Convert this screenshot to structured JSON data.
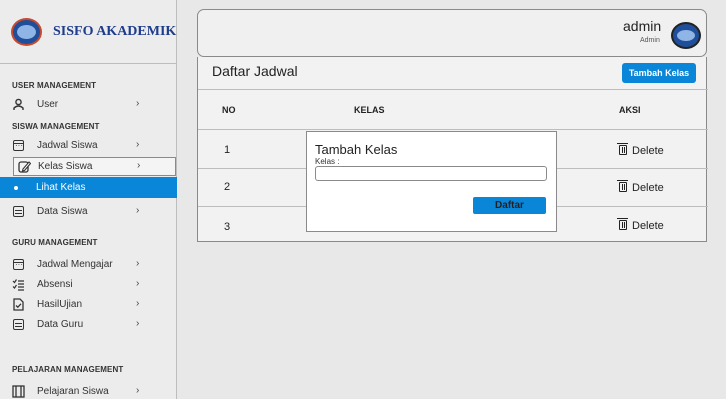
{
  "brand": {
    "title": "SISFO AKADEMIK"
  },
  "header": {
    "admin_name": "admin",
    "admin_role": "Admin"
  },
  "sidebar": {
    "user_section": "USER MANAGEMENT",
    "user_item": "User",
    "siswa_section": "SISWA MANAGEMENT",
    "siswa_items": [
      "Jadwal Siswa",
      "Kelas Siswa",
      "Lihat Kelas",
      "Data Siswa"
    ],
    "guru_section": "GURU MANAGEMENT",
    "guru_items": [
      "Jadwal Mengajar",
      "Absensi",
      "HasilUjian",
      "Data Guru"
    ],
    "pelajaran_section": "PELAJARAN MANAGEMENT",
    "pelajaran_items": [
      "Pelajaran Siswa"
    ],
    "active_item": "Lihat Kelas"
  },
  "main": {
    "title": "Daftar Jadwal",
    "add_button": "Tambah Kelas",
    "columns": [
      "NO",
      "KELAS",
      "AKSI"
    ],
    "rows": [
      {
        "no": "1",
        "kelas": "",
        "aksi": "Delete"
      },
      {
        "no": "2",
        "kelas": "",
        "aksi": "Delete"
      },
      {
        "no": "3",
        "kelas": "",
        "aksi": "Delete"
      }
    ]
  },
  "modal": {
    "title": "Tambah Kelas",
    "field_label": "Kelas :",
    "field_value": "",
    "submit_label": "Daftar"
  },
  "colors": {
    "accent": "#0a86d8",
    "brand": "#1e3c8c",
    "sidebar_bg": "#ececec"
  },
  "icons": {
    "user": "user-icon",
    "jadwal": "calendar-icon",
    "kelas": "edit-icon",
    "data": "list-icon",
    "absensi": "checklist-icon",
    "ujian": "document-check-icon",
    "pelajaran": "book-icon",
    "delete": "trash-icon"
  }
}
